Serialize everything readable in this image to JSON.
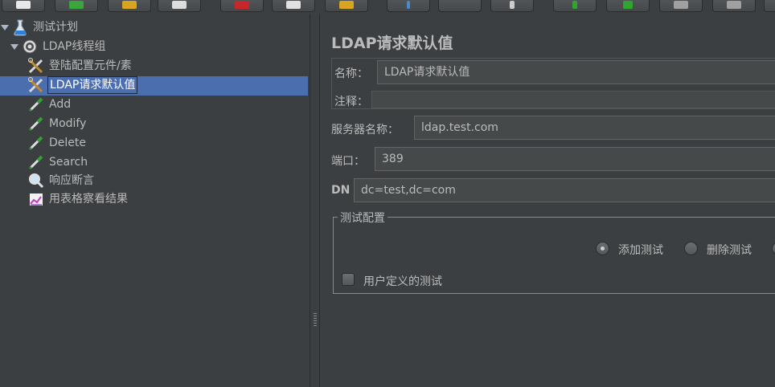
{
  "tree": {
    "items": [
      {
        "label": "测试计划",
        "icon": "flask-icon"
      },
      {
        "label": "LDAP线程组",
        "icon": "gear-icon"
      },
      {
        "label": "登陆配置元件/素",
        "icon": "wrench-scissors-icon"
      },
      {
        "label": "LDAP请求默认值",
        "icon": "wrench-scissors-icon"
      },
      {
        "label": "Add",
        "icon": "pipette-icon"
      },
      {
        "label": "Modify",
        "icon": "pipette-icon"
      },
      {
        "label": "Delete",
        "icon": "pipette-icon"
      },
      {
        "label": "Search",
        "icon": "pipette-icon"
      },
      {
        "label": "响应断言",
        "icon": "magnifier-icon"
      },
      {
        "label": "用表格察看结果",
        "icon": "chart-icon"
      }
    ]
  },
  "panel": {
    "title": "LDAP请求默认值",
    "name_label": "名称：",
    "name_value": "LDAP请求默认值",
    "comment_label": "注释：",
    "server_label": "服务器名称：",
    "server_value": "ldap.test.com",
    "port_label": "端口：",
    "port_value": "389",
    "dn_label": "DN",
    "dn_value": "dc=test,dc=com",
    "group": {
      "legend": "测试配置",
      "radio_add": "添加测试",
      "radio_delete": "删除测试",
      "checkbox_user": "用户定义的测试"
    }
  },
  "colors": {
    "selection": "#4b6eaf",
    "background": "#3c3f41"
  }
}
